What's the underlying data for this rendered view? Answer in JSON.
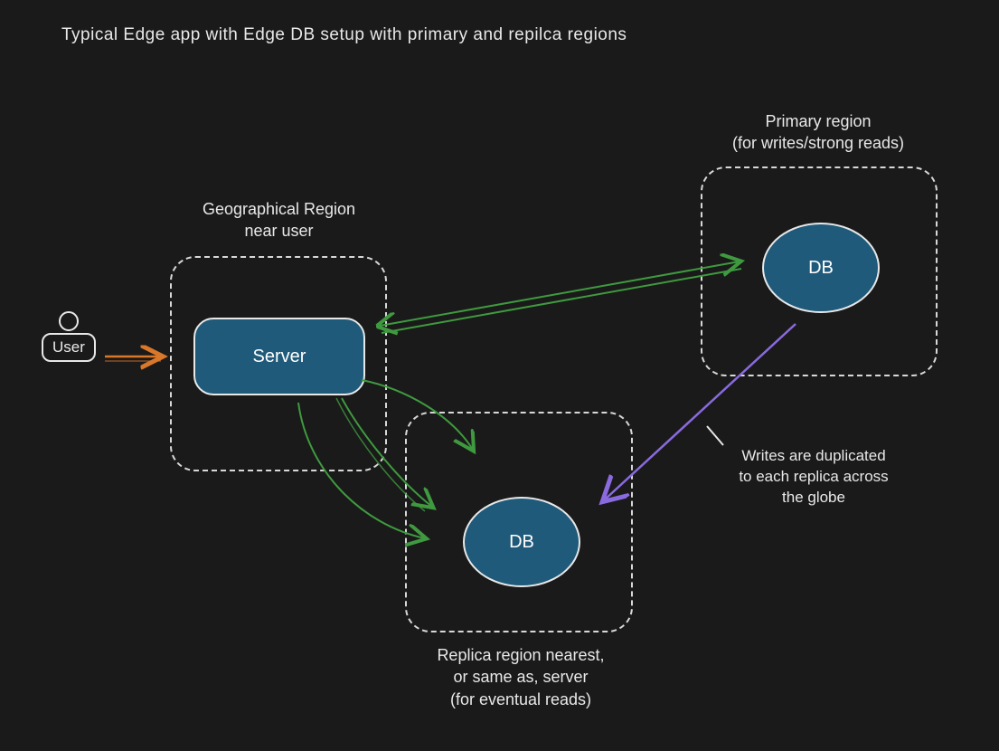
{
  "title": "Typical Edge app with Edge DB setup with primary and repilca regions",
  "user": {
    "label": "User"
  },
  "geoRegion": {
    "label": "Geographical Region\nnear user"
  },
  "server": {
    "label": "Server"
  },
  "primaryRegion": {
    "label": "Primary region\n(for writes/strong reads)"
  },
  "primaryDB": {
    "label": "DB"
  },
  "replicaRegion": {
    "label": "Replica region nearest,\nor same as, server\n(for eventual reads)"
  },
  "replicaDB": {
    "label": "DB"
  },
  "replicationNote": {
    "text": "Writes are duplicated\nto each replica across\nthe globe"
  },
  "colors": {
    "arrowOrange": "#d9772b",
    "arrowGreen": "#3f9a3f",
    "arrowPurple": "#8a6adf",
    "stroke": "#e8e8e8",
    "fillBlue": "#1f5a7a"
  }
}
